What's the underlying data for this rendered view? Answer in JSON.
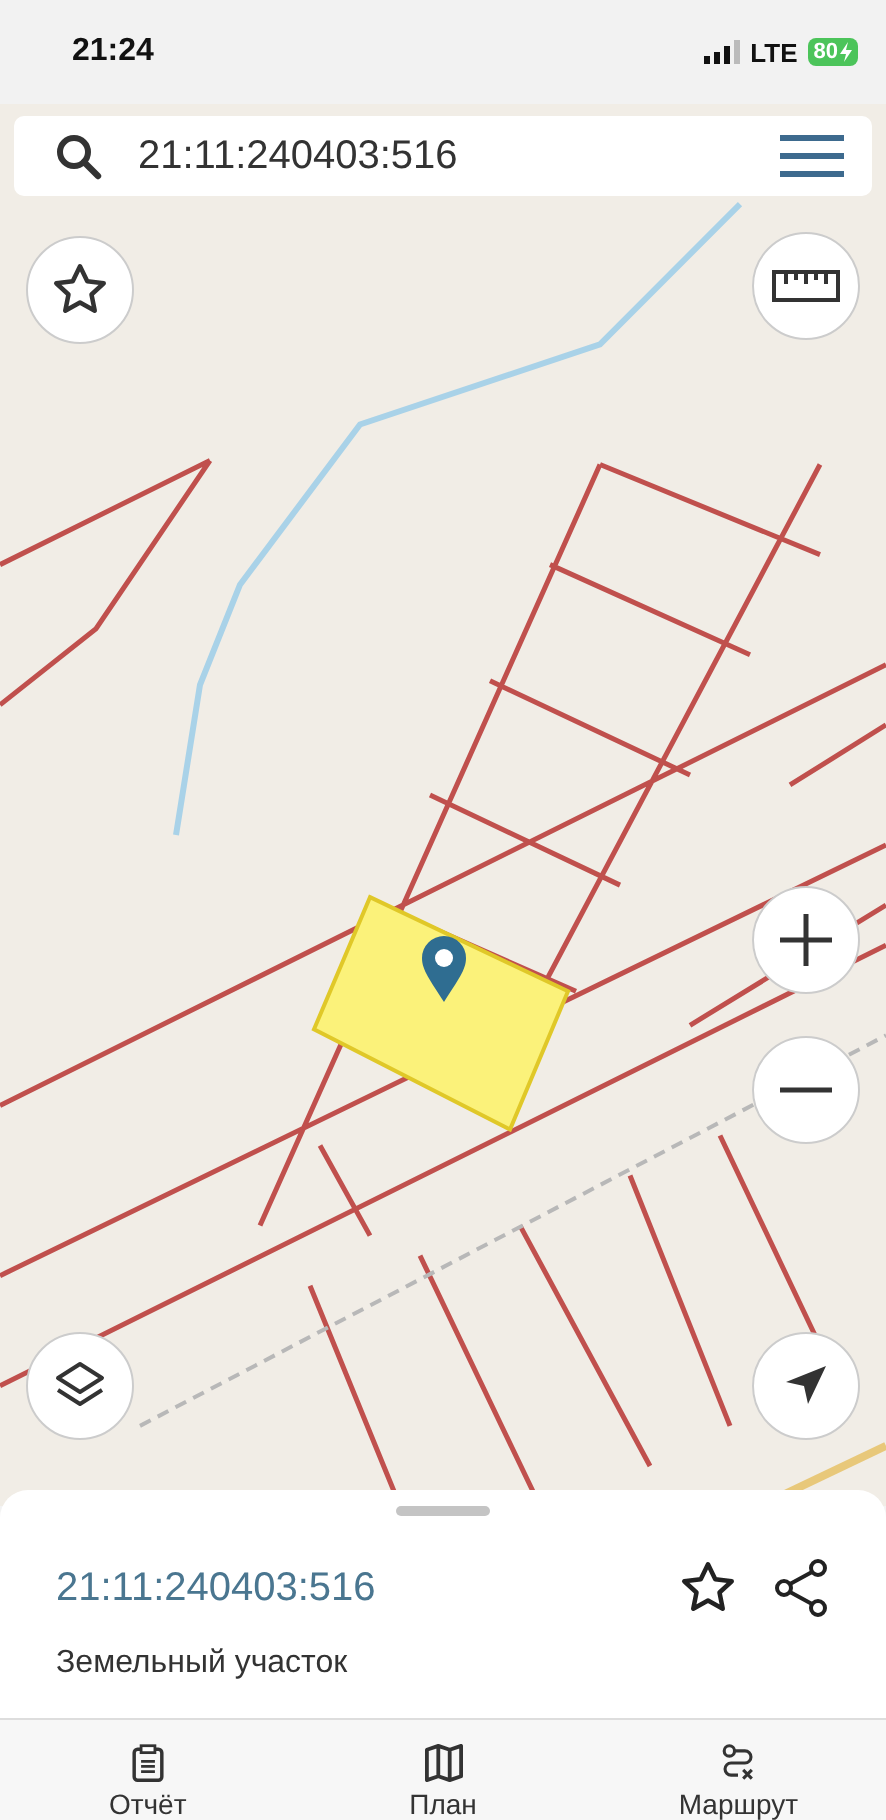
{
  "status_bar": {
    "time": "21:24",
    "network": "LTE",
    "battery": "80"
  },
  "search": {
    "value": "21:11:240403:516"
  },
  "sheet": {
    "title": "21:11:240403:516",
    "subtitle": "Земельный участок"
  },
  "nav": [
    {
      "kind": "report",
      "label": "Отчёт"
    },
    {
      "kind": "plan",
      "label": "План"
    },
    {
      "kind": "route",
      "label": "Маршрут"
    }
  ]
}
